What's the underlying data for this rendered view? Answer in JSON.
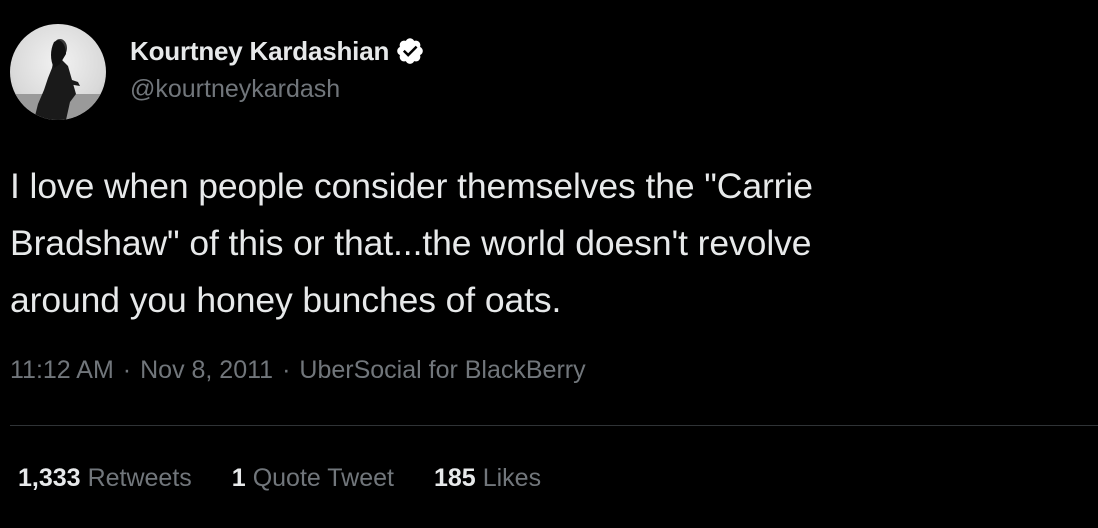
{
  "user": {
    "display_name": "Kourtney Kardashian",
    "handle": "@kourtneykardash",
    "verified_icon": "verified-badge-icon",
    "verified_color": "#ffffff"
  },
  "tweet": {
    "text": "I love when people consider themselves the \"Carrie\nBradshaw\" of this or that...the world doesn't revolve\naround you honey bunches of oats."
  },
  "meta": {
    "time": "11:12 AM",
    "separator": "·",
    "date": "Nov 8, 2011",
    "source": "UberSocial for BlackBerry"
  },
  "stats": [
    {
      "count": "1,333",
      "label": "Retweets"
    },
    {
      "count": "1",
      "label": "Quote Tweet"
    },
    {
      "count": "185",
      "label": "Likes"
    }
  ],
  "colors": {
    "background": "#000000",
    "primary_text": "#e7e9ea",
    "secondary_text": "#71767b",
    "divider": "#2f3336"
  }
}
